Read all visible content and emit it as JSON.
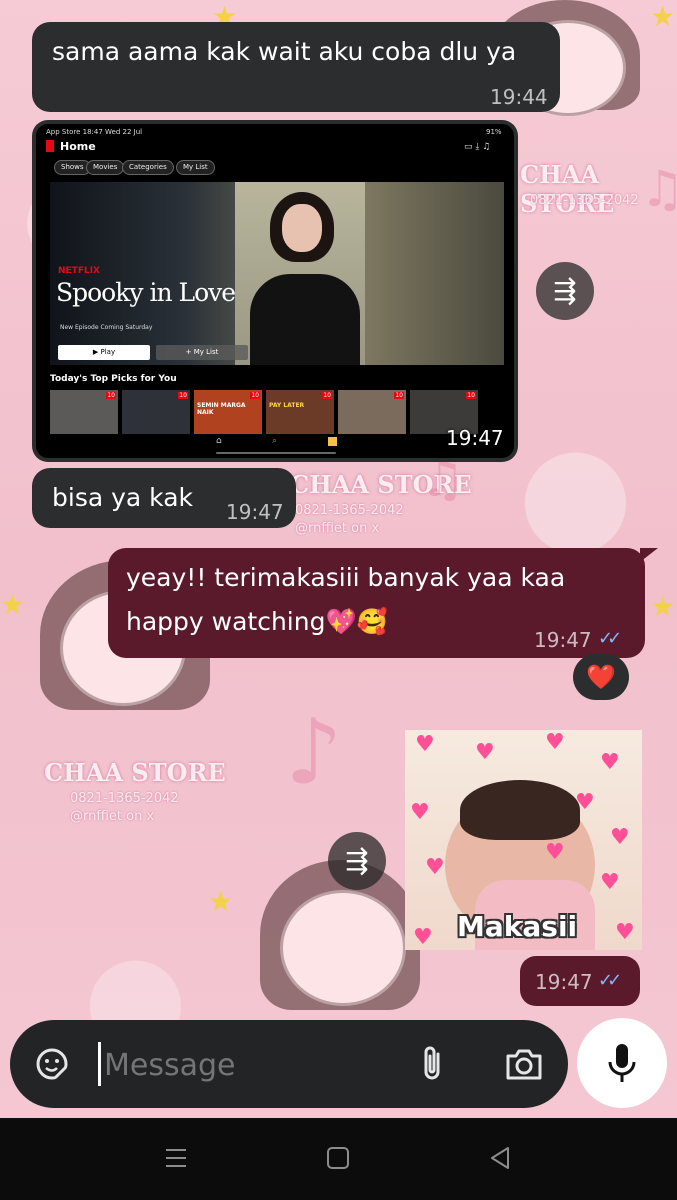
{
  "messages": {
    "m1": {
      "text": "sama aama kak wait aku coba dlu ya",
      "time": "19:44"
    },
    "image": {
      "time": "19:47",
      "screen": {
        "status_left": "App Store 18:47 Wed 22 Jul",
        "status_right": "91%",
        "app_title": "Home",
        "pills": [
          "Shows",
          "Movies",
          "Categories",
          "My List"
        ],
        "brand": "NETFLIX",
        "show_title": "Spooky in Love",
        "episode_note": "New Episode Coming Saturday",
        "play_label": "Play",
        "mylist_label": "My List",
        "row_title": "Today's Top Picks for You",
        "thumb_badges": [
          "10",
          "10",
          "10",
          "10",
          "10",
          "10"
        ],
        "thumb_texts": [
          "",
          "",
          "SEMIN MARGA NAIK",
          "PAY LATER",
          "",
          ""
        ]
      }
    },
    "m2": {
      "text": "bisa ya kak",
      "time": "19:47"
    },
    "m3": {
      "line1": "yeay!! terimakasiii banyak yaa kaa",
      "line2": "happy watching💖🥰",
      "time": "19:47",
      "ticks": "✓✓"
    },
    "reaction": "❤️",
    "sticker": {
      "label": "Makasii",
      "time": "19:47",
      "ticks": "✓✓"
    }
  },
  "composer": {
    "placeholder": "Message"
  },
  "wallpaper": {
    "brand": "CHAA STORE",
    "phone": "0821-1365-2042",
    "handle": "@rnffiet on x"
  },
  "colors": {
    "incoming": "#2b2d2e",
    "outgoing": "#5a1a2c",
    "read_ticks": "#7fb8ff",
    "accent": "#e50914"
  },
  "icons": [
    "sticker-icon",
    "attach-icon",
    "camera-icon",
    "mic-icon",
    "forward-icon",
    "menu-nav-icon",
    "home-nav-icon",
    "back-nav-icon"
  ]
}
